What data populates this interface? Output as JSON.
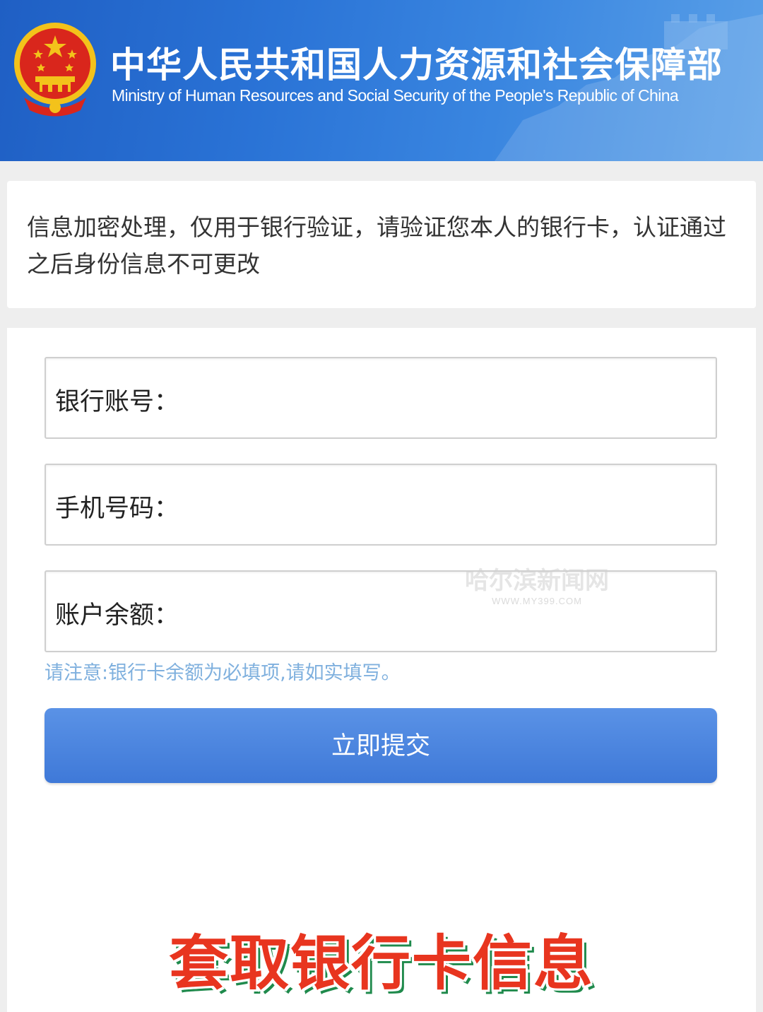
{
  "header": {
    "title_cn": "中华人民共和国人力资源和社会保障部",
    "title_en": "Ministry of Human Resources and Social Security of the People's Republic of China"
  },
  "notice": {
    "text": "信息加密处理，仅用于银行验证，请验证您本人的银行卡，认证通过之后身份信息不可更改"
  },
  "form": {
    "fields": [
      {
        "label": "银行账号：",
        "value": "",
        "placeholder": ""
      },
      {
        "label": "手机号码：",
        "value": "",
        "placeholder": ""
      },
      {
        "label": "账户余额：",
        "value": "",
        "placeholder": ""
      }
    ],
    "hint": "请注意:银行卡余额为必填项,请如实填写。",
    "submit_label": "立即提交"
  },
  "watermark": {
    "line1": "哈尔滨新闻网",
    "line2": "WWW.MY399.COM"
  },
  "caption": "套取银行卡信息",
  "colors": {
    "header_blue": "#2a73d6",
    "button_blue": "#4a84dc",
    "hint_blue": "#7fb0de",
    "caption_red": "#e8351f",
    "caption_shadow_green": "#1f8a4c"
  }
}
